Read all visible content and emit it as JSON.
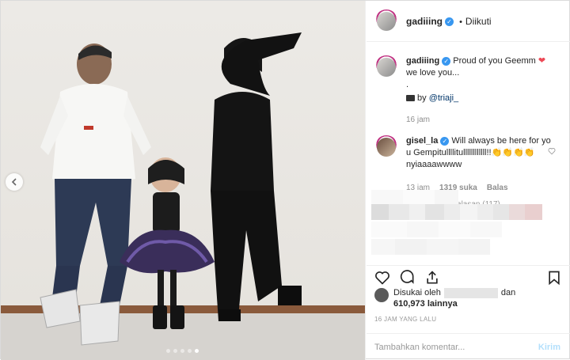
{
  "post": {
    "author": "gadiiing",
    "follow_status": "Diikuti",
    "follow_separator": "•",
    "caption": {
      "username": "gadiiing",
      "text": "Proud of you Geemm",
      "heart": "❤",
      "line2": "we love you...",
      "line3": ".",
      "credit_prefix": "by",
      "credit_handle": "@triaji_",
      "time": "16 jam"
    },
    "comment": {
      "username": "gisel_la",
      "text": "Will always be here for you Gempitullllitullllllllllll!!",
      "emoji": "👏👏👏👏",
      "line2": "nyiaaaawwww",
      "time": "13 jam",
      "likes": "1319 suka",
      "reply": "Balas",
      "view_replies": "Lihat balasan (117)"
    },
    "likes_prefix": "Disukai oleh",
    "likes_and": "dan",
    "likes_count": "610,973 lainnya",
    "timestamp": "16 JAM YANG LALU",
    "comment_placeholder": "Tambahkan komentar...",
    "submit_label": "Kirim"
  },
  "carousel": {
    "count": 5,
    "active_index": 4
  },
  "colors": {
    "verified": "#3897f0",
    "link": "#003569",
    "submit_disabled": "#b2dffc",
    "heart": "#ed4956"
  },
  "icons": [
    "chevron-left-icon",
    "heart-icon",
    "comment-icon",
    "share-icon",
    "bookmark-icon",
    "verified-badge-icon"
  ]
}
